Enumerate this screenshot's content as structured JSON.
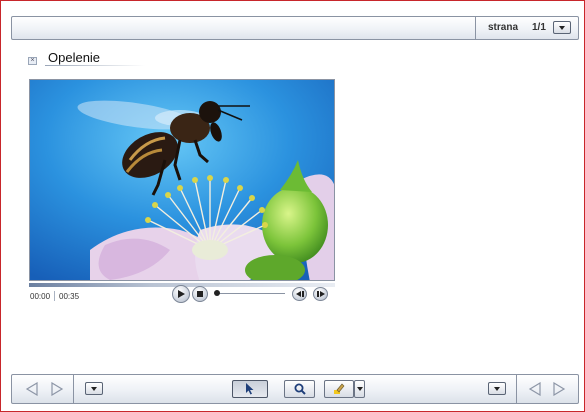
{
  "header": {
    "page_label": "strana",
    "page_number": "1/1",
    "page_select_icon": "chevron-down-icon"
  },
  "content": {
    "title": "Opelenie",
    "close_icon": "close-icon"
  },
  "video": {
    "current_time": "00:00",
    "duration": "00:35",
    "progress": 0
  },
  "toolbar": {
    "tools": [
      "pointer-icon",
      "zoom-icon",
      "highlighter-icon"
    ],
    "nav_icons": [
      "arrow-left-icon",
      "arrow-right-icon"
    ]
  },
  "colors": {
    "border_accent": "#c8262b",
    "bar_border": "#8a93a3",
    "video_sky": "#2a93e0"
  }
}
